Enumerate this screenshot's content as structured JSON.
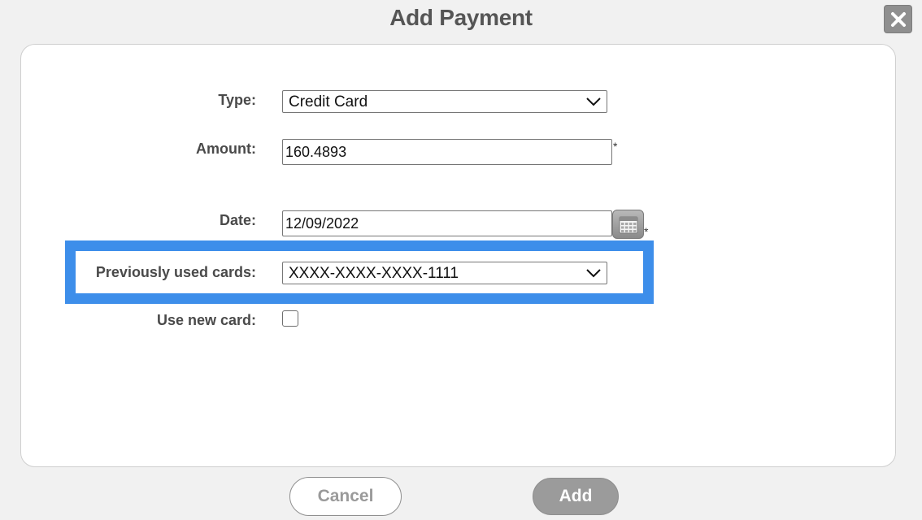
{
  "dialog": {
    "title": "Add Payment"
  },
  "form": {
    "type": {
      "label": "Type:",
      "value": "Credit Card"
    },
    "amount": {
      "label": "Amount:",
      "value": "160.4893",
      "required_mark": "*"
    },
    "date": {
      "label": "Date:",
      "value": "12/09/2022",
      "required_mark": "*",
      "icon": "calendar-icon"
    },
    "previous_cards": {
      "label": "Previously used cards:",
      "value": "XXXX-XXXX-XXXX-1111"
    },
    "new_card": {
      "label": "Use new card:",
      "checked": false
    }
  },
  "buttons": {
    "cancel_label": "Cancel",
    "add_label": "Add"
  },
  "icons": {
    "close": "close-icon",
    "dropdown": "chevron-down-icon",
    "calendar": "calendar-icon"
  },
  "colors": {
    "highlight": "#3d8eea",
    "background": "#f1f1f1",
    "panel": "#ffffff",
    "add_button": "#9b9b9b"
  }
}
